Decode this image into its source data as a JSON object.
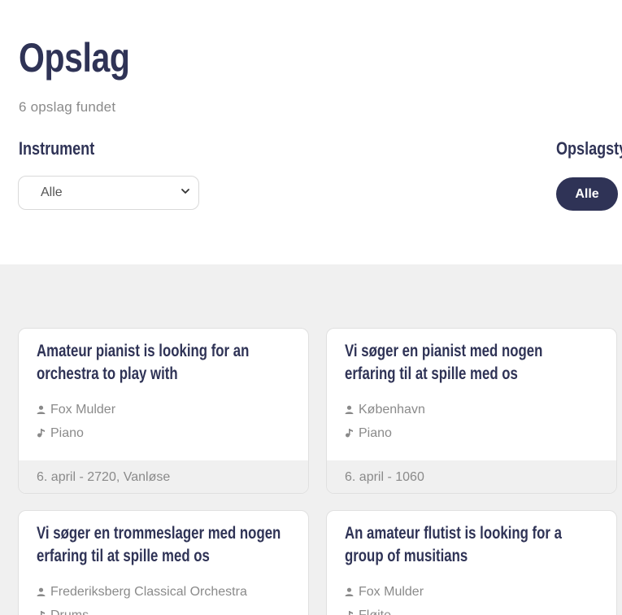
{
  "header": {
    "title": "Opslag",
    "result_count": "6 opslag fundet"
  },
  "filters": {
    "instrument_label": "Instrument",
    "instrument_selected": "Alle",
    "type_label": "Opslagsty",
    "type_selected": "Alle"
  },
  "posts": [
    {
      "title": "Amateur pianist is looking for an orchestra to play with",
      "person": "Fox Mulder",
      "instrument": "Piano",
      "footer": "6. april - 2720, Vanløse"
    },
    {
      "title": "Vi søger en pianist med nogen erfaring til at spille med os",
      "person": "København",
      "instrument": "Piano",
      "footer": "6. april - 1060"
    },
    {
      "title": "Vi søger en trommeslager med nogen erfaring til at spille med os",
      "person": "Frederiksberg Classical Orchestra",
      "instrument": "Drums"
    },
    {
      "title": "An amateur flutist is looking for a group of musitians",
      "person": "Fox Mulder",
      "instrument": "Fløjte"
    }
  ],
  "icons": {
    "person": "user-icon",
    "instrument": "music-note-icon",
    "select": "chevron-down-icon"
  },
  "colors": {
    "primary": "#2f3356",
    "muted_text": "#8a8a8a",
    "section_bg": "#f0f0f0"
  }
}
